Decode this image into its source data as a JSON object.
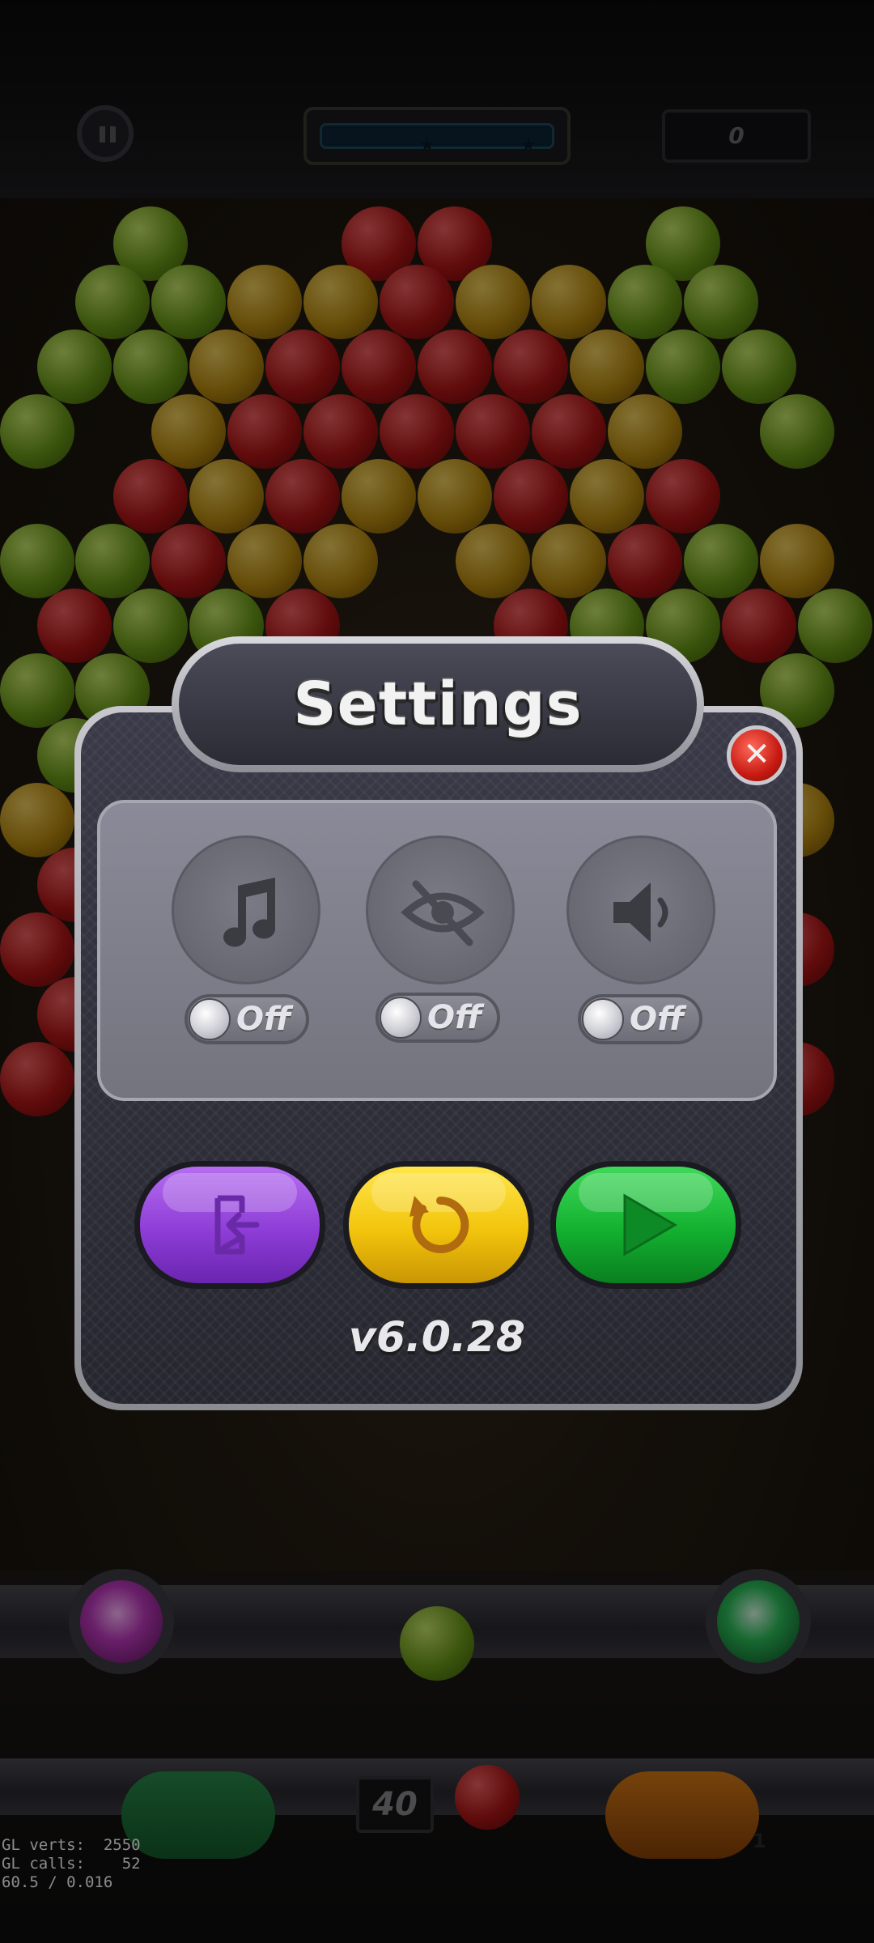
{
  "hud": {
    "score": "0",
    "shots_left": "40"
  },
  "settings": {
    "title": "Settings",
    "music": {
      "state": "Off"
    },
    "visibility": {
      "state": "Off"
    },
    "sound": {
      "state": "Off"
    },
    "version": "v6.0.28"
  },
  "debug": {
    "text": "GL verts:  2550\nGL calls:    52\n60.5 / 0.016"
  },
  "booster_counts": {
    "right_capsule": "1"
  },
  "icons": {
    "pause": "pause-icon",
    "close": "close-icon",
    "music": "music-note-icon",
    "visibility": "eye-off-icon",
    "sound": "speaker-icon",
    "exit": "exit-icon",
    "restart": "restart-icon",
    "play": "play-icon"
  },
  "colors": {
    "purple_button": "#8e3dd6",
    "yellow_button": "#f2c40c",
    "green_button": "#13b030",
    "close_button": "#c61a12"
  }
}
